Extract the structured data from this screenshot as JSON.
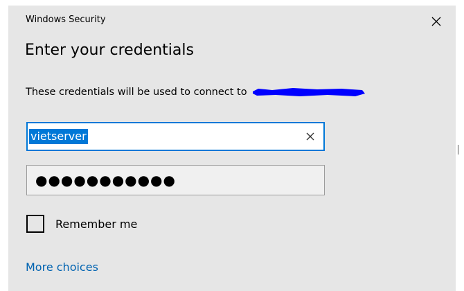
{
  "window": {
    "app_title": "Windows Security",
    "close_icon": "close-icon"
  },
  "dialog": {
    "heading": "Enter your credentials",
    "message": "These credentials will be used to connect to",
    "redaction_color": "#0000ff"
  },
  "username": {
    "value": "vietserver",
    "clear_icon": "clear-icon",
    "selection_color": "#0078d7"
  },
  "password": {
    "masked_value": "●●●●●●●●●●●"
  },
  "remember": {
    "label": "Remember me",
    "checked": false
  },
  "more_choices": {
    "label": "More choices"
  },
  "colors": {
    "dialog_background": "#e6e6e6",
    "accent": "#0078d7",
    "link": "#0063b1"
  }
}
